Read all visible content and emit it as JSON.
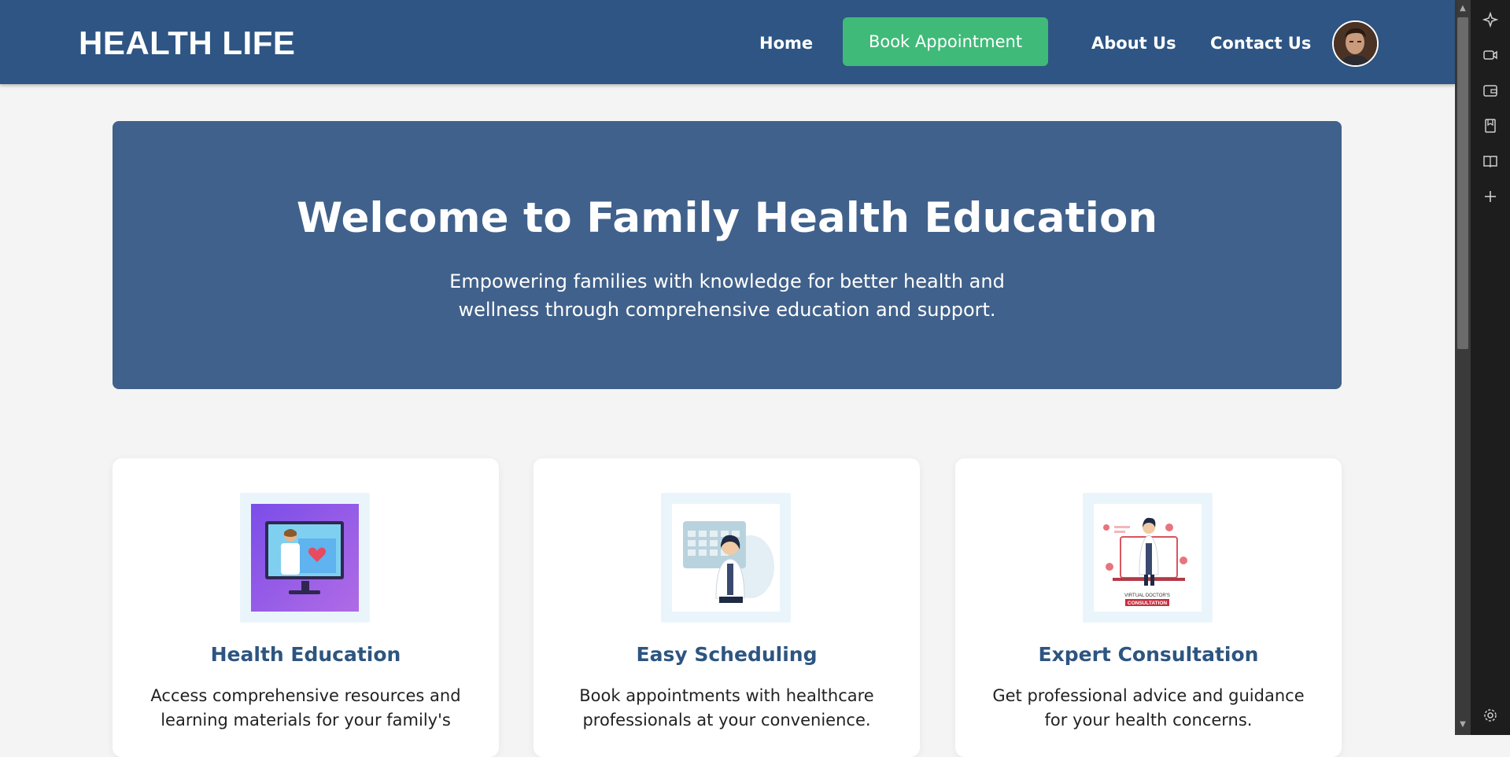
{
  "nav": {
    "brand": "HEALTH LIFE",
    "home": "Home",
    "book_appointment": "Book Appointment",
    "about": "About Us",
    "contact": "Contact Us"
  },
  "hero": {
    "title": "Welcome to Family Health Education",
    "subtitle": "Empowering families with knowledge for better health and wellness through comprehensive education and support."
  },
  "features": [
    {
      "title": "Health Education",
      "description": "Access comprehensive resources and learning materials for your family's"
    },
    {
      "title": "Easy Scheduling",
      "description": "Book appointments with healthcare professionals at your convenience."
    },
    {
      "title": "Expert Consultation",
      "description": "Get professional advice and guidance for your health concerns.",
      "image_caption_line1": "VIRTUAL DOCTOR'S",
      "image_caption_line2": "CONSULTATION"
    }
  ],
  "side_panel_icons": [
    "sparkle-icon",
    "video-icon",
    "wallet-icon",
    "bookmark-icon",
    "reader-icon",
    "plus-icon",
    "settings-icon"
  ],
  "colors": {
    "navbar": "#2e5583",
    "hero": "#40618b",
    "accent_green": "#3fba78",
    "card_title": "#2d5580",
    "page_bg": "#f4f4f4"
  }
}
